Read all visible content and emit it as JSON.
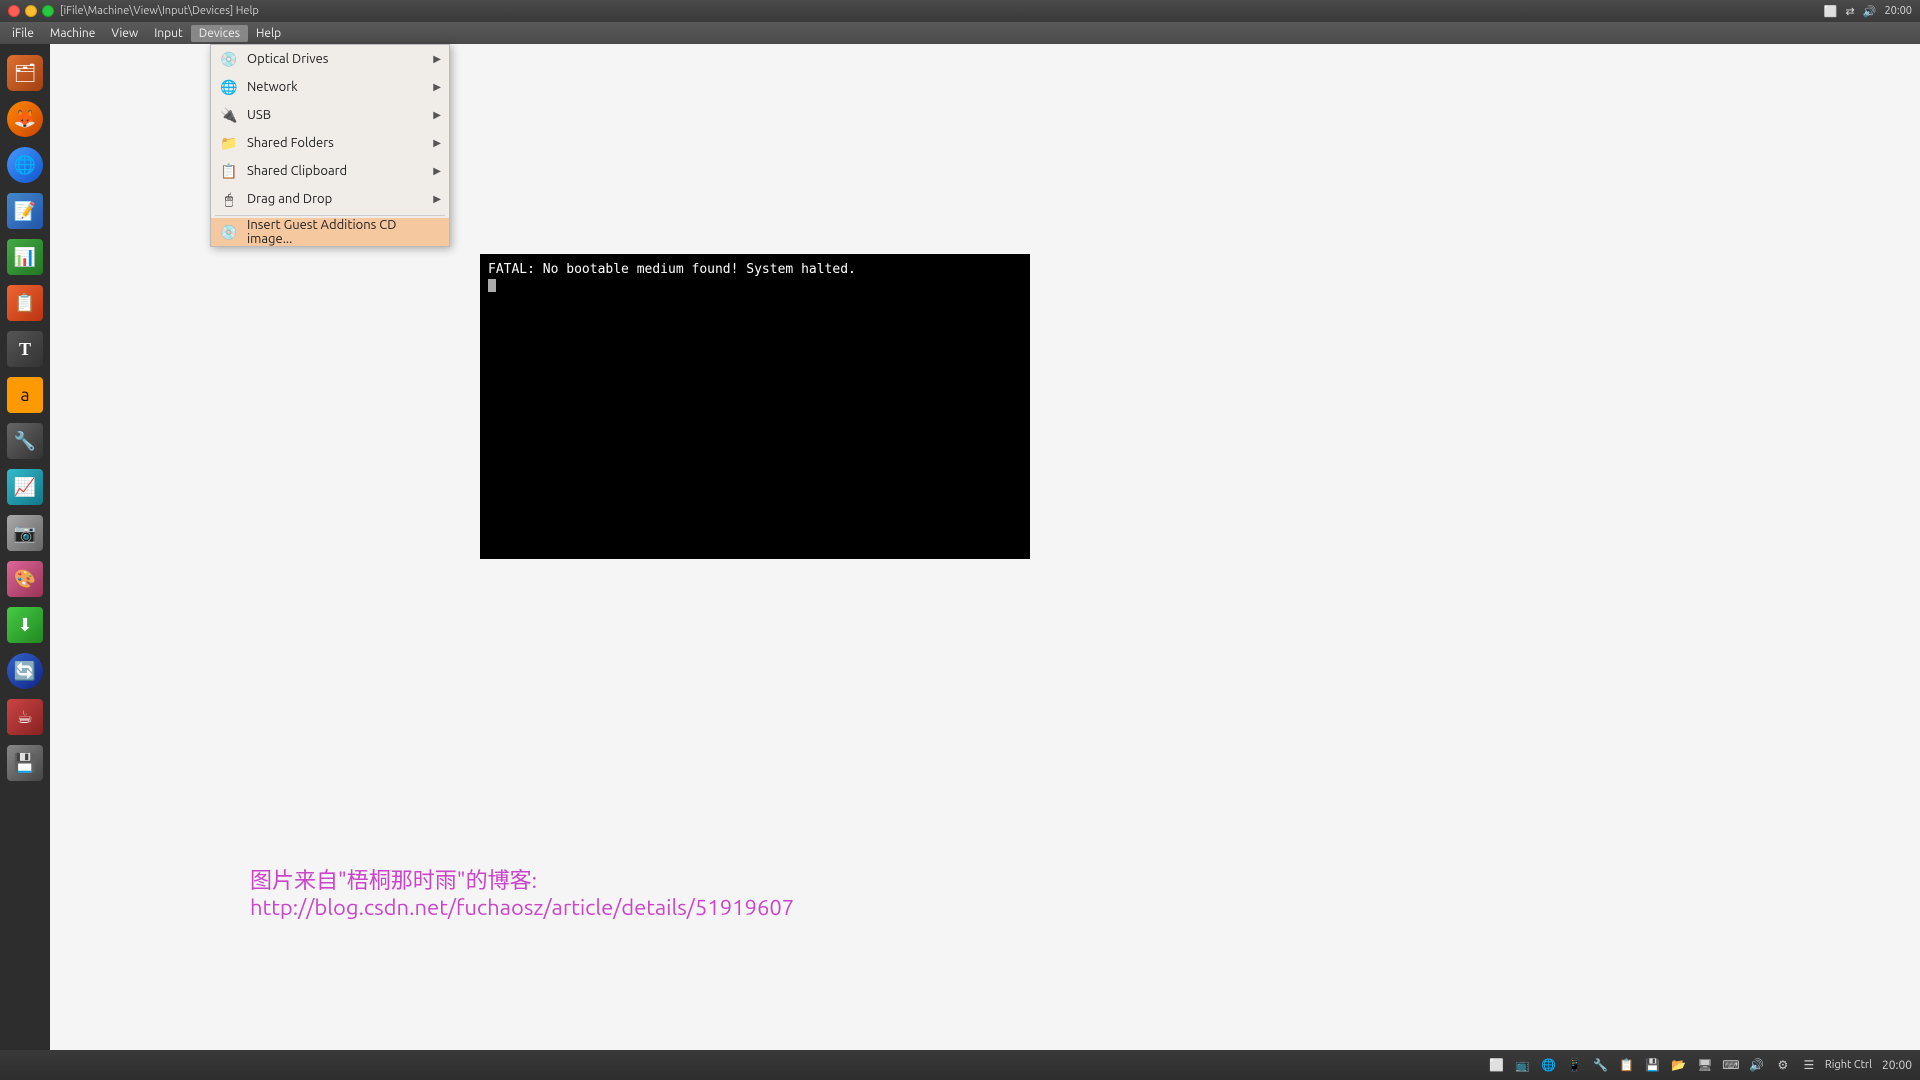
{
  "titlebar": {
    "title": "[iFile\\Machine\\View\\Input\\Devices]  Help",
    "time": "20:00",
    "dots": [
      "red",
      "yellow",
      "green"
    ]
  },
  "menubar": {
    "items": [
      {
        "label": "iFile",
        "active": false
      },
      {
        "label": "Machine",
        "active": false
      },
      {
        "label": "View",
        "active": false
      },
      {
        "label": "Input",
        "active": false
      },
      {
        "label": "Devices",
        "active": true
      },
      {
        "label": "Help",
        "active": false
      }
    ]
  },
  "devices_menu": {
    "items": [
      {
        "id": "optical",
        "label": "Optical Drives",
        "icon": "💿",
        "has_arrow": true,
        "highlighted": false
      },
      {
        "id": "network",
        "label": "Network",
        "icon": "🌐",
        "has_arrow": true,
        "highlighted": false
      },
      {
        "id": "usb",
        "label": "USB",
        "icon": "🔌",
        "has_arrow": true,
        "highlighted": false
      },
      {
        "id": "shared_folders",
        "label": "Shared Folders",
        "icon": "📁",
        "has_arrow": true,
        "highlighted": false
      },
      {
        "id": "shared_clipboard",
        "label": "Shared Clipboard",
        "icon": "📋",
        "has_arrow": true,
        "highlighted": false
      },
      {
        "id": "drag_drop",
        "label": "Drag and Drop",
        "icon": "🖱",
        "has_arrow": true,
        "highlighted": false
      },
      {
        "id": "insert_guest",
        "label": "Insert Guest Additions CD image...",
        "icon": "💿",
        "has_arrow": false,
        "highlighted": true
      }
    ]
  },
  "vm_screen": {
    "fatal_text": "FATAL: No bootable medium found! System halted.",
    "cursor": "_"
  },
  "watermark": {
    "line1": "图片来自\"梧桐那时雨\"的博客:",
    "line2": "http://blog.csdn.net/fuchaosz/article/details/51919607"
  },
  "sidebar": {
    "apps": [
      {
        "name": "files",
        "icon": "🗂",
        "color": "orange"
      },
      {
        "name": "firefox",
        "icon": "🦊",
        "color": "orange"
      },
      {
        "name": "chrome",
        "icon": "🌐",
        "color": "blue"
      },
      {
        "name": "writer",
        "icon": "📝",
        "color": "blue"
      },
      {
        "name": "calc",
        "icon": "📊",
        "color": "green"
      },
      {
        "name": "impress",
        "icon": "📊",
        "color": "orange"
      },
      {
        "name": "fonts",
        "icon": "T",
        "color": "dark"
      },
      {
        "name": "amazon",
        "icon": "📦",
        "color": "yellow"
      },
      {
        "name": "tools",
        "icon": "🔧",
        "color": "dark"
      },
      {
        "name": "monitor",
        "icon": "📈",
        "color": "teal"
      },
      {
        "name": "camera",
        "icon": "📷",
        "color": "dark"
      },
      {
        "name": "paint",
        "icon": "🎨",
        "color": "purple"
      },
      {
        "name": "download",
        "icon": "⬇",
        "color": "green"
      },
      {
        "name": "sync",
        "icon": "🔄",
        "color": "blue"
      },
      {
        "name": "java",
        "icon": "☕",
        "color": "red"
      },
      {
        "name": "drive",
        "icon": "💾",
        "color": "dark"
      }
    ]
  },
  "taskbar": {
    "time": "20:00",
    "right_ctrl_label": "Right Ctrl",
    "icons_count": 14
  }
}
